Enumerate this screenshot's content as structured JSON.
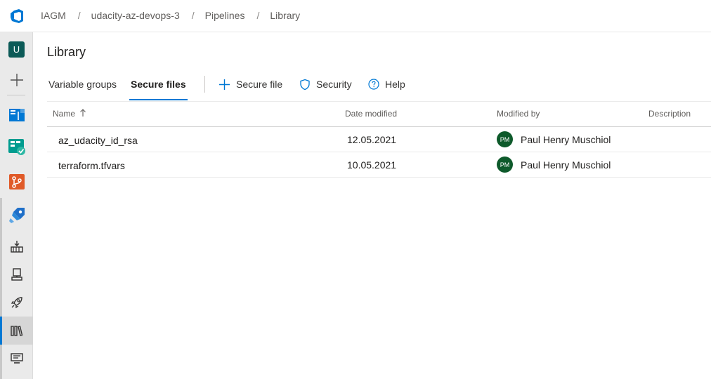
{
  "breadcrumb": {
    "items": [
      "IAGM",
      "udacity-az-devops-3",
      "Pipelines",
      "Library"
    ],
    "separator": "/"
  },
  "rail": {
    "project_initial": "U",
    "items": [
      "project-avatar",
      "add",
      "overview",
      "boards",
      "repos",
      "pipelines",
      "pipelines-builds",
      "environments",
      "releases",
      "library",
      "task-groups"
    ],
    "selected": "library"
  },
  "page": {
    "title": "Library"
  },
  "tabs": [
    {
      "label": "Variable groups",
      "active": false
    },
    {
      "label": "Secure files",
      "active": true
    }
  ],
  "commands": {
    "add_secure_file": "Secure file",
    "security": "Security",
    "help": "Help"
  },
  "table": {
    "columns": [
      "Name",
      "Date modified",
      "Modified by",
      "Description"
    ],
    "sort": {
      "column": "Name",
      "direction": "ascending"
    },
    "rows": [
      {
        "name": "az_udacity_id_rsa",
        "date": "12.05.2021",
        "initials": "PM",
        "modified_by": "Paul Henry Muschiol",
        "description": ""
      },
      {
        "name": "terraform.tfvars",
        "date": "10.05.2021",
        "initials": "PM",
        "modified_by": "Paul Henry Muschiol",
        "description": ""
      }
    ]
  },
  "colors": {
    "accent": "#0078d4",
    "project_avatar": "#0c5a57",
    "user_avatar": "#0e5a2b"
  }
}
